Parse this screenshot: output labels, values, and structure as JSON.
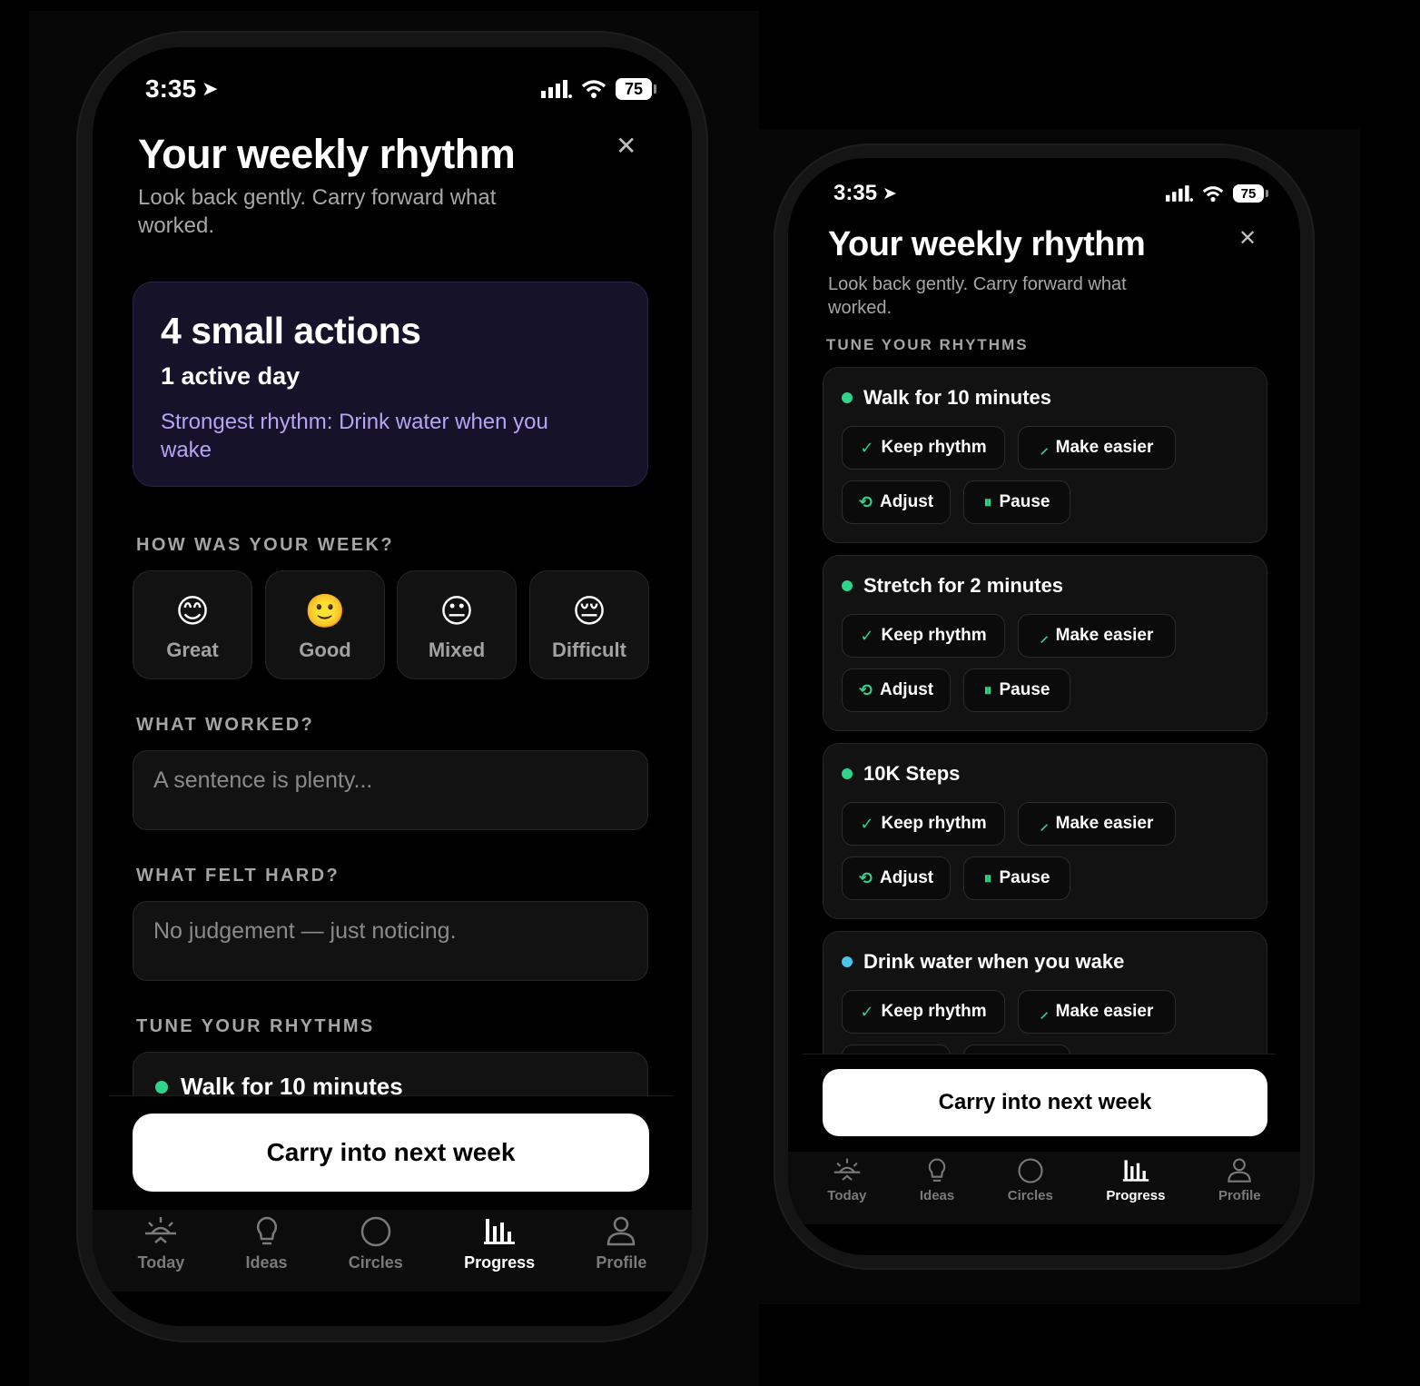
{
  "status": {
    "time": "3:35",
    "battery": "75"
  },
  "header": {
    "title": "Your weekly rhythm",
    "subtitle_line1": "Look back gently. Carry forward what",
    "subtitle_line2": "worked.",
    "close_symbol": "✕"
  },
  "summary": {
    "actions": "4 small actions",
    "active_days": "1 active day",
    "strongest_line1": "Strongest rhythm: Drink water when you",
    "strongest_line2": "wake"
  },
  "week_section": {
    "label": "HOW WAS YOUR WEEK?",
    "options": [
      {
        "emoji": "😊",
        "label": "Great"
      },
      {
        "emoji": "🙂",
        "label": "Good"
      },
      {
        "emoji": "😐",
        "label": "Mixed"
      },
      {
        "emoji": "😔",
        "label": "Difficult"
      }
    ]
  },
  "worked": {
    "label": "WHAT WORKED?",
    "placeholder": "A sentence is plenty..."
  },
  "hard": {
    "label": "WHAT FELT HARD?",
    "placeholder": "No judgement — just noticing."
  },
  "tune": {
    "label": "TUNE YOUR RHYTHMS",
    "actions": {
      "keep": "Keep rhythm",
      "easier": "Make easier",
      "adjust": "Adjust",
      "pause": "Pause"
    },
    "rhythms": [
      {
        "name": "Walk for 10 minutes",
        "dot_color": "#2fd38a"
      },
      {
        "name": "Stretch for 2 minutes",
        "dot_color": "#2fd38a"
      },
      {
        "name": "10K Steps",
        "dot_color": "#2fd38a"
      },
      {
        "name": "Drink water when you wake",
        "dot_color": "#4cc3ea"
      }
    ]
  },
  "cta": {
    "label": "Carry into next week"
  },
  "tabs": [
    {
      "label": "Today",
      "icon": "sunrise-icon",
      "active": false
    },
    {
      "label": "Ideas",
      "icon": "lightbulb-icon",
      "active": false
    },
    {
      "label": "Circles",
      "icon": "circle-icon",
      "active": false
    },
    {
      "label": "Progress",
      "icon": "bar-chart-icon",
      "active": true
    },
    {
      "label": "Profile",
      "icon": "person-icon",
      "active": false
    }
  ],
  "colors": {
    "accent_green": "#2fd38a",
    "accent_blue": "#4cc3ea",
    "accent_purple": "#b8a4f4",
    "card_purple": "#15122a"
  }
}
